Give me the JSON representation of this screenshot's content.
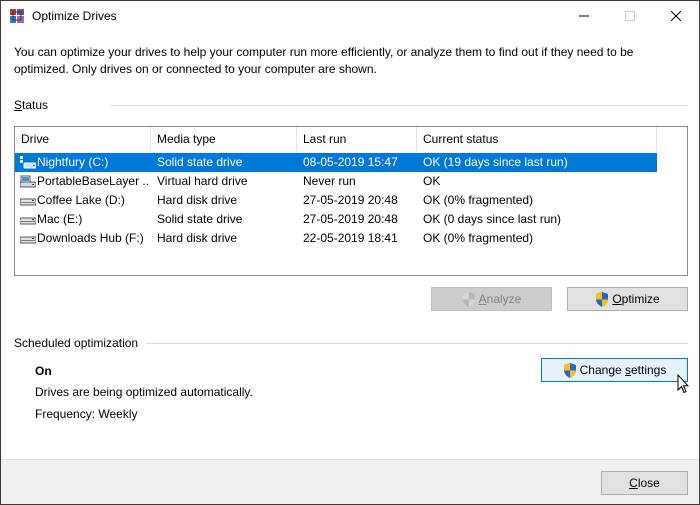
{
  "window": {
    "title": "Optimize Drives"
  },
  "intro": {
    "text": "You can optimize your drives to help your computer run more efficiently, or analyze them to find out if they need to be optimized. Only drives on or connected to your computer are shown."
  },
  "status": {
    "label": "Status",
    "columns": [
      "Drive",
      "Media type",
      "Last run",
      "Current status"
    ],
    "rows": [
      {
        "drive": "Nightfury (C:)",
        "media": "Solid state drive",
        "last_run": "08-05-2019 15:47",
        "status": "OK (19 days since last run)",
        "selected": true,
        "icon": "windows-drive-icon"
      },
      {
        "drive": "PortableBaseLayer ...",
        "media": "Virtual hard drive",
        "last_run": "Never run",
        "status": "OK",
        "selected": false,
        "icon": "virtual-drive-icon"
      },
      {
        "drive": "Coffee Lake (D:)",
        "media": "Hard disk drive",
        "last_run": "27-05-2019 20:48",
        "status": "OK (0% fragmented)",
        "selected": false,
        "icon": "hard-drive-icon"
      },
      {
        "drive": "Mac (E:)",
        "media": "Solid state drive",
        "last_run": "27-05-2019 20:48",
        "status": "OK (0 days since last run)",
        "selected": false,
        "icon": "hard-drive-icon"
      },
      {
        "drive": "Downloads Hub (F:)",
        "media": "Hard disk drive",
        "last_run": "22-05-2019 18:41",
        "status": "OK (0% fragmented)",
        "selected": false,
        "icon": "hard-drive-icon"
      }
    ]
  },
  "actions": {
    "analyze_prefix": "A",
    "analyze_rest": "nalyze",
    "optimize_prefix": "O",
    "optimize_rest": "ptimize"
  },
  "schedule": {
    "label": "Scheduled optimization",
    "state": "On",
    "description": "Drives are being optimized automatically.",
    "frequency": "Frequency: Weekly",
    "change_prefix": "Change ",
    "change_underlined": "s",
    "change_rest": "ettings"
  },
  "footer": {
    "close_prefix": "C",
    "close_rest": "lose"
  },
  "colors": {
    "selection": "#0078d7",
    "shield_blue": "#2b63c5",
    "shield_yellow": "#f5c21b"
  }
}
